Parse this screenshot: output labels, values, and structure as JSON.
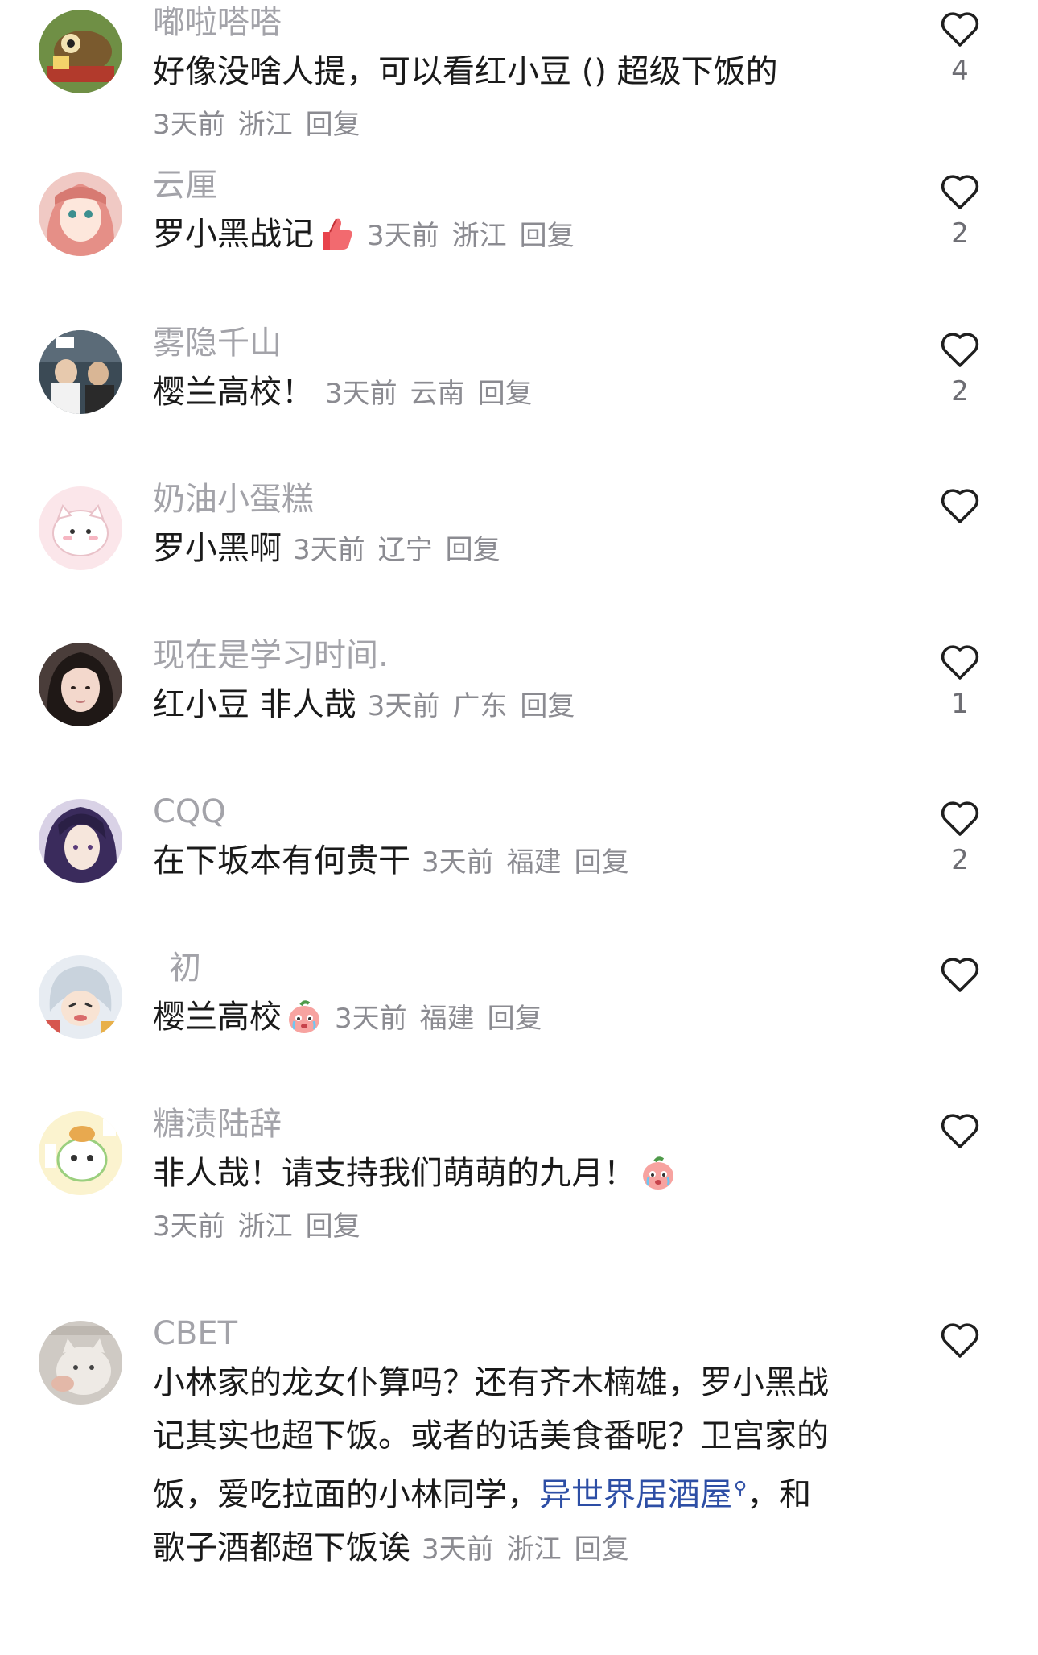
{
  "meta_labels": {
    "reply": "回复"
  },
  "comments": [
    {
      "username": "嘟啦嗒嗒",
      "text": "好像没啥人提，可以看红小豆 () 超级下饭的",
      "time": "3天前",
      "location": "浙江",
      "likes": "4",
      "avatar": "cartoon-bug-avatar"
    },
    {
      "username": "云厘",
      "text": "罗小黑战记",
      "emoji": "thumbs-up-emoji",
      "time": "3天前",
      "location": "浙江",
      "likes": "2",
      "avatar": "anime-girl-pink-hair-avatar"
    },
    {
      "username": "雾隐千山",
      "text": "樱兰高校！",
      "time": "3天前",
      "location": "云南",
      "likes": "2",
      "avatar": "tv-screenshot-avatar"
    },
    {
      "username": "奶油小蛋糕",
      "text": "罗小黑啊",
      "time": "3天前",
      "location": "辽宁",
      "likes": "",
      "avatar": "white-cat-sticker-avatar"
    },
    {
      "username": "现在是学习时间.",
      "text": "红小豆 非人哉",
      "time": "3天前",
      "location": "广东",
      "likes": "1",
      "avatar": "girl-photo-avatar"
    },
    {
      "username": "CQQ",
      "text": "在下坂本有何贵干",
      "time": "3天前",
      "location": "福建",
      "likes": "2",
      "avatar": "anime-man-purple-hair-avatar"
    },
    {
      "username": "初",
      "text": "樱兰高校",
      "emoji": "crying-peach-emoji",
      "time": "3天前",
      "location": "福建",
      "likes": "",
      "avatar": "anime-silver-hair-avatar"
    },
    {
      "username": "糖渍陆辞",
      "text": "非人哉！请支持我们萌萌的九月！",
      "emoji": "crying-peach-emoji",
      "time": "3天前",
      "location": "浙江",
      "likes": "",
      "avatar": "cartoon-sticker-avatar"
    },
    {
      "username": "CBET",
      "text_lines": [
        "小林家的龙女仆算吗？还有齐木楠雄，罗小黑战",
        "记其实也超下饭。或者的话美食番呢？卫宫家的",
        "饭，爱吃拉面的小林同学，"
      ],
      "link": "异世界居酒屋",
      "after_link": "，和",
      "last_line": "歌子酒都超下饭诶",
      "time": "3天前",
      "location": "浙江",
      "likes": "",
      "avatar": "cat-meme-avatar"
    }
  ]
}
